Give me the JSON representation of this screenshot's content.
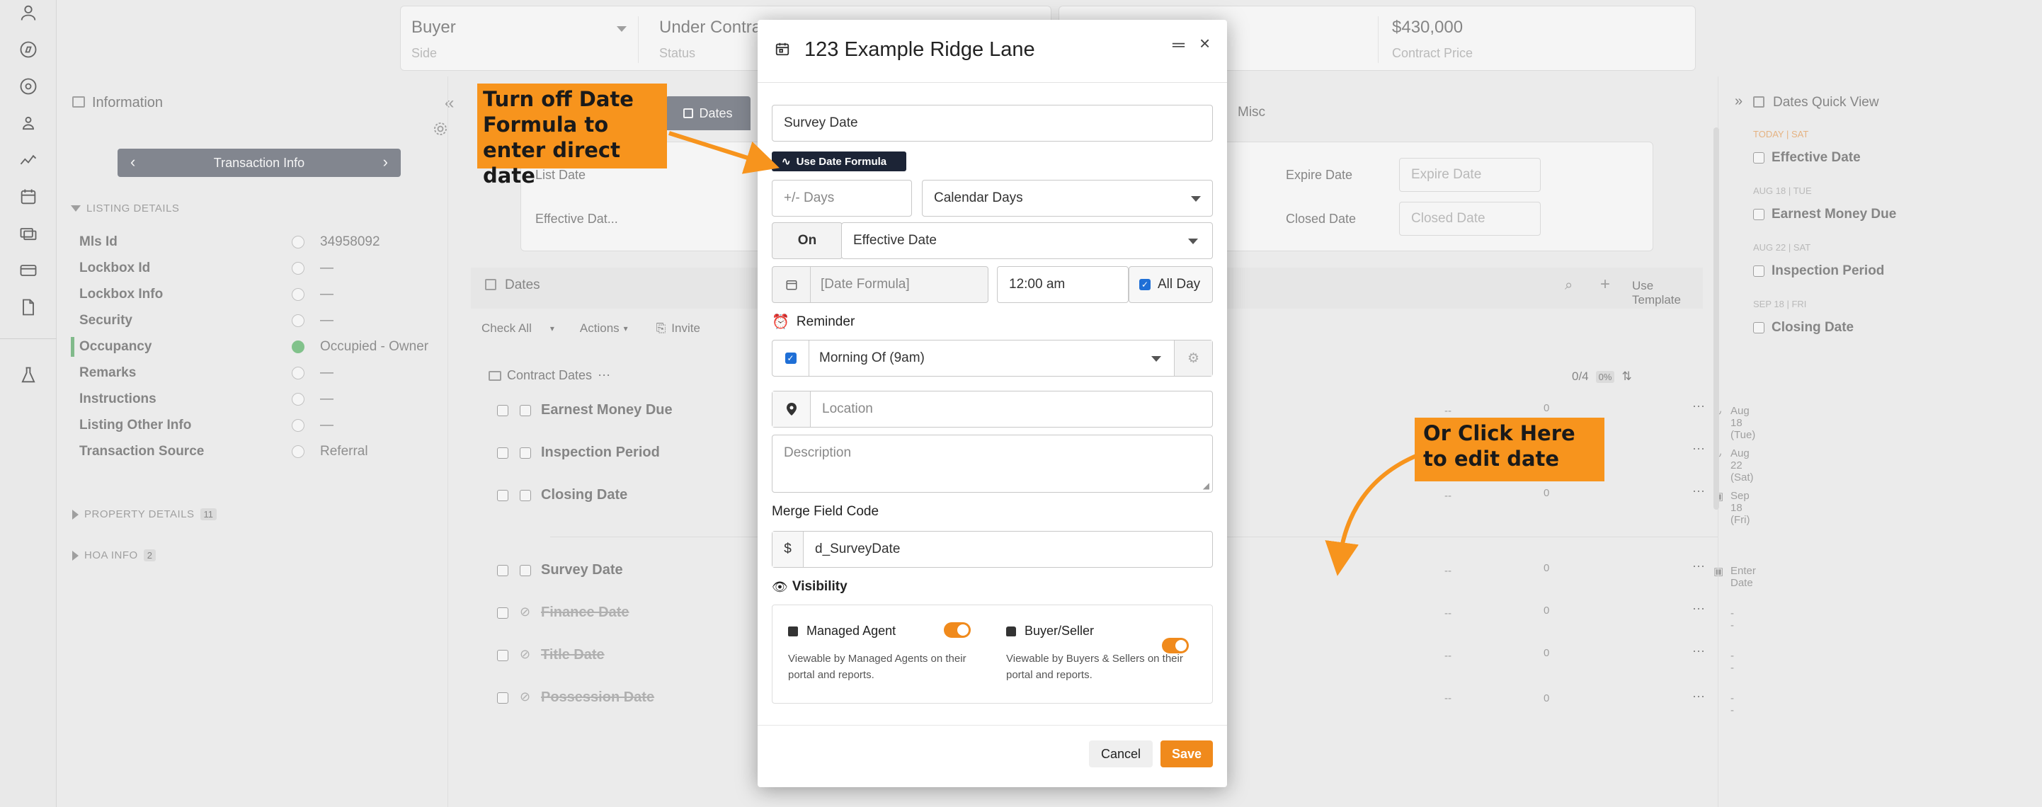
{
  "header": {
    "side_value": "Buyer",
    "side_label": "Side",
    "status_value": "Under Contract",
    "status_label": "Status",
    "price_value": "$430,000",
    "price_label": "Contract Price"
  },
  "info_panel": {
    "title": "Information",
    "nav_label": "Transaction Info",
    "listing_section": "LISTING DETAILS",
    "fields": [
      {
        "label": "Mls Id",
        "value": "34958092"
      },
      {
        "label": "Lockbox Id",
        "value": "—"
      },
      {
        "label": "Lockbox Info",
        "value": "—"
      },
      {
        "label": "Security",
        "value": "—"
      },
      {
        "label": "Occupancy",
        "value": "Occupied - Owner"
      },
      {
        "label": "Remarks",
        "value": "—"
      },
      {
        "label": "Instructions",
        "value": "—"
      },
      {
        "label": "Listing Other Info",
        "value": "—"
      },
      {
        "label": "Transaction Source",
        "value": "Referral"
      }
    ],
    "property_section": "PROPERTY DETAILS",
    "property_count": "11",
    "hoa_section": "HOA INFO",
    "hoa_count": "2"
  },
  "tabs": {
    "dates": "Dates",
    "misc": "Misc"
  },
  "date_fields": {
    "list_date": "List Date",
    "effective_date": "Effective Dat...",
    "expire_date": "Expire Date",
    "expire_placeholder": "Expire Date",
    "closed_date": "Closed Date",
    "closed_placeholder": "Closed Date"
  },
  "dates_section": {
    "title": "Dates",
    "use_template": "Use Template",
    "check_all": "Check All",
    "actions": "Actions",
    "invite": "Invite",
    "group": "Contract Dates",
    "count": "0/4",
    "percent": "0%"
  },
  "date_rows": [
    {
      "name": "Earnest Money Due",
      "date": "Aug 18 (Tue)",
      "time": "--",
      "comments": "0",
      "struck": false
    },
    {
      "name": "Inspection Period",
      "date": "Aug 22 (Sat)",
      "time": "--",
      "comments": "0",
      "struck": false
    },
    {
      "name": "Closing Date",
      "date": "Sep 18 (Fri)",
      "time": "--",
      "comments": "0",
      "struck": false
    },
    {
      "name": "Survey Date",
      "date": "Enter Date",
      "time": "--",
      "comments": "0",
      "struck": false
    },
    {
      "name": "Finance Date",
      "date": "--",
      "time": "--",
      "comments": "0",
      "struck": true
    },
    {
      "name": "Title Date",
      "date": "--",
      "time": "--",
      "comments": "0",
      "struck": true
    },
    {
      "name": "Possession Date",
      "date": "--",
      "time": "--",
      "comments": "0",
      "struck": true
    }
  ],
  "quick_view": {
    "title": "Dates Quick View",
    "items": [
      {
        "head": "TODAY | SAT",
        "label": "Effective Date",
        "today": true
      },
      {
        "head": "AUG 18 | TUE",
        "label": "Earnest Money Due",
        "today": false
      },
      {
        "head": "AUG 22 | SAT",
        "label": "Inspection Period",
        "today": false
      },
      {
        "head": "SEP 18 | FRI",
        "label": "Closing Date",
        "today": false
      }
    ]
  },
  "modal": {
    "title": "123 Example Ridge Lane",
    "name_value": "Survey Date",
    "formula_button": "Use Date Formula",
    "days_placeholder": "+/- Days",
    "days_type": "Calendar Days",
    "on_label": "On",
    "relative_to": "Effective Date",
    "date_formula_placeholder": "[Date Formula]",
    "time_value": "12:00 am",
    "all_day": "All Day",
    "reminder_label": "Reminder",
    "reminder_value": "Morning Of (9am)",
    "location_placeholder": "Location",
    "description_placeholder": "Description",
    "merge_label": "Merge Field Code",
    "merge_prefix": "$",
    "merge_value": "d_SurveyDate",
    "visibility_label": "Visibility",
    "managed_agent": "Managed Agent",
    "managed_agent_desc": "Viewable by Managed Agents on their portal and reports.",
    "buyer_seller": "Buyer/Seller",
    "buyer_seller_desc": "Viewable by Buyers & Sellers on their portal and reports.",
    "cancel": "Cancel",
    "save": "Save"
  },
  "callouts": {
    "left": "Turn off Date Formula to enter direct date",
    "right": "Or Click Here to edit date"
  },
  "colors": {
    "accent": "#f08a1c",
    "callout": "#f7941d",
    "navy": "#1c2436",
    "today": "#e07b1a"
  }
}
